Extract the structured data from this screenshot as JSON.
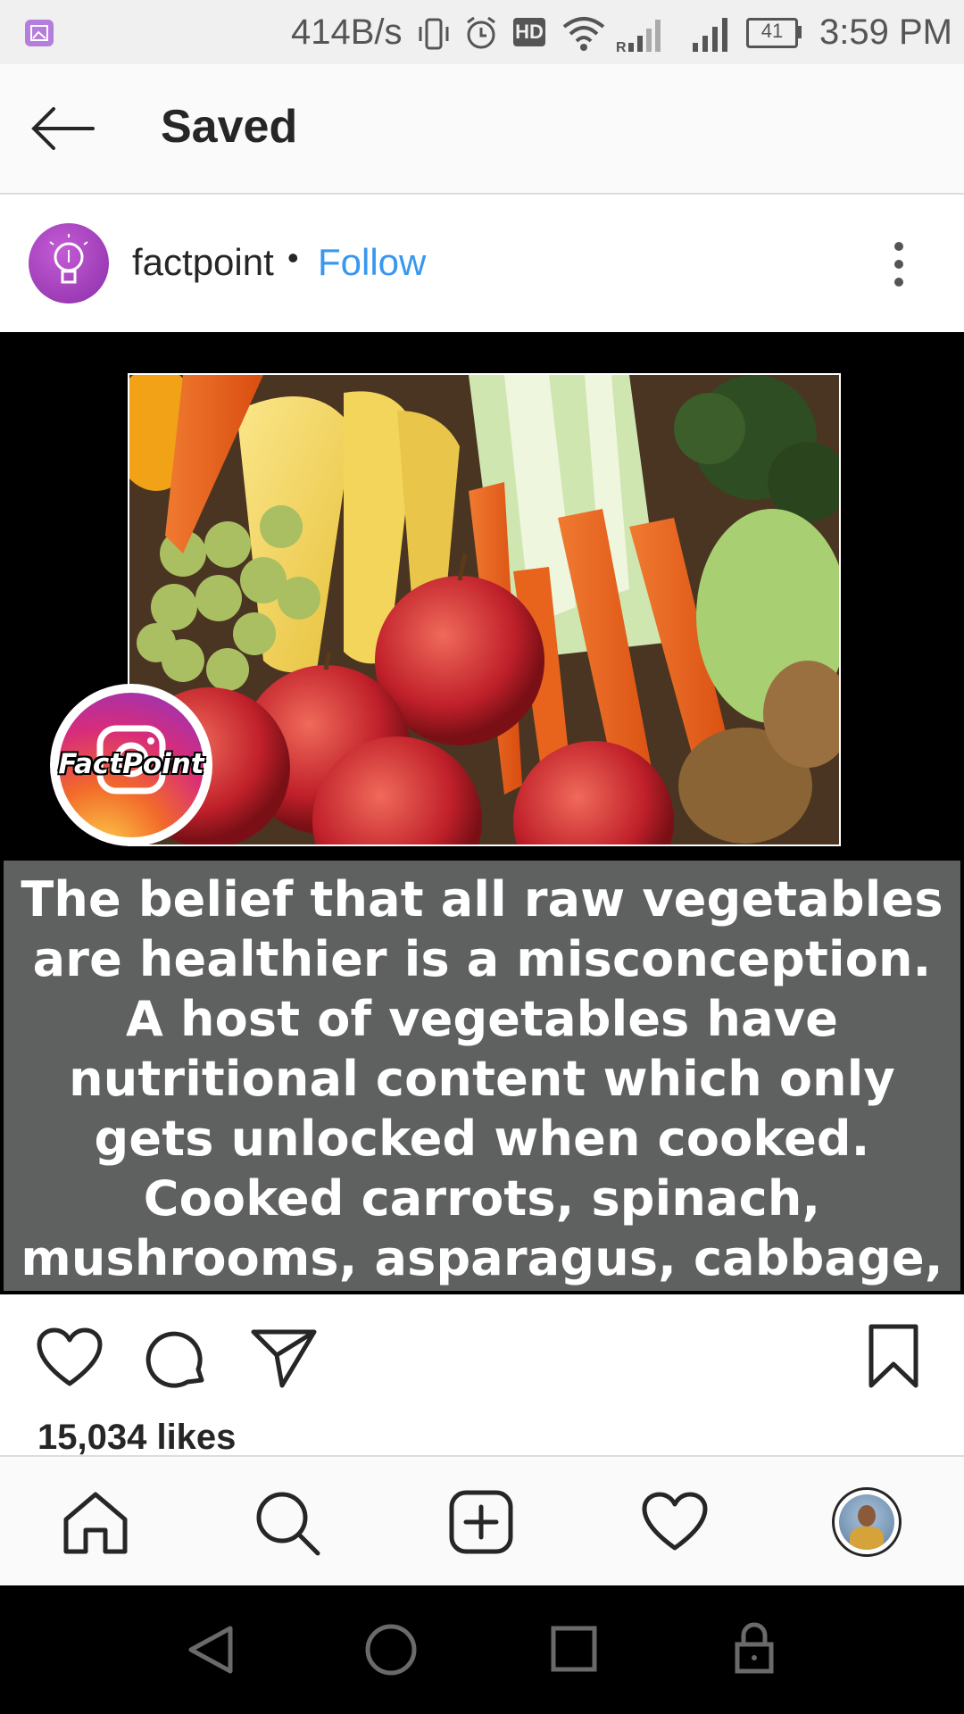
{
  "status_bar": {
    "speed": "414B/s",
    "battery": "41",
    "time": "3:59 PM",
    "hd_badge": "HD",
    "network_label": "R"
  },
  "header": {
    "title": "Saved",
    "back_icon": "arrow-left-icon"
  },
  "post": {
    "username": "factpoint",
    "separator": "•",
    "follow_label": "Follow",
    "avatar_icon": "lightbulb-icon",
    "more_icon": "more-vertical-icon",
    "image": {
      "watermark": "FactPoint",
      "caption": "The belief that all raw vegetables are healthier is a misconception. A host of vegetables have nutritional content which only gets unlocked when cooked. Cooked carrots, spinach, mushrooms, asparagus, cabbage, peppers are healthier than their raw counterparts."
    },
    "likes": "15,034 likes"
  },
  "actions": [
    "heart-icon",
    "comment-icon",
    "share-icon",
    "bookmark-icon"
  ],
  "bottom_nav": [
    "home-icon",
    "search-icon",
    "add-icon",
    "activity-icon",
    "profile-avatar"
  ],
  "system_nav": [
    "back-triangle-icon",
    "home-circle-icon",
    "recents-square-icon",
    "lock-icon"
  ],
  "colors": {
    "accent": "#3897f0",
    "caption_bg": "#5f6060",
    "post_bg": "#000000"
  }
}
